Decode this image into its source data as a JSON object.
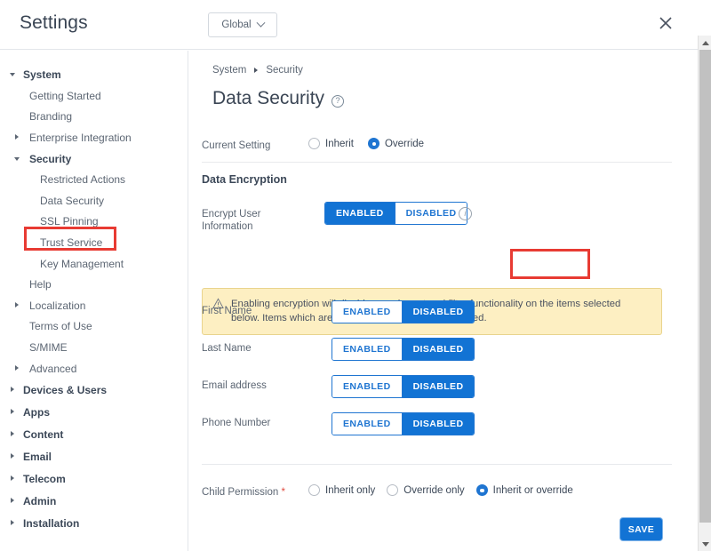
{
  "header": {
    "title": "Settings",
    "scope_label": "Global",
    "scope_icon": "chevron-down-icon",
    "close_icon": "close-icon"
  },
  "sidebar": {
    "items": [
      {
        "label": "System",
        "level": 0,
        "expanded": true,
        "icon": "caret-down-icon",
        "bold": true
      },
      {
        "label": "Getting Started",
        "level": 1,
        "expanded": null,
        "icon": "",
        "bold": false
      },
      {
        "label": "Branding",
        "level": 1,
        "expanded": null,
        "icon": "",
        "bold": false
      },
      {
        "label": "Enterprise Integration",
        "level": 1,
        "expanded": false,
        "icon": "caret-right-icon",
        "bold": false
      },
      {
        "label": "Security",
        "level": 1,
        "expanded": true,
        "icon": "caret-down-icon",
        "bold": true
      },
      {
        "label": "Restricted Actions",
        "level": 2,
        "expanded": null,
        "icon": "",
        "bold": false
      },
      {
        "label": "Data Security",
        "level": 2,
        "expanded": null,
        "icon": "",
        "bold": true
      },
      {
        "label": "SSL Pinning",
        "level": 2,
        "expanded": null,
        "icon": "",
        "bold": false
      },
      {
        "label": "Trust Service",
        "level": 2,
        "expanded": null,
        "icon": "",
        "bold": false
      },
      {
        "label": "Key Management",
        "level": 2,
        "expanded": null,
        "icon": "",
        "bold": false
      },
      {
        "label": "Help",
        "level": 1,
        "expanded": null,
        "icon": "",
        "bold": false
      },
      {
        "label": "Localization",
        "level": 1,
        "expanded": false,
        "icon": "caret-right-icon",
        "bold": false
      },
      {
        "label": "Terms of Use",
        "level": 1,
        "expanded": null,
        "icon": "",
        "bold": false
      },
      {
        "label": "S/MIME",
        "level": 1,
        "expanded": null,
        "icon": "",
        "bold": false
      },
      {
        "label": "Advanced",
        "level": 1,
        "expanded": false,
        "icon": "caret-right-icon",
        "bold": false
      },
      {
        "label": "Devices & Users",
        "level": 0,
        "expanded": false,
        "icon": "caret-right-icon",
        "bold": true
      },
      {
        "label": "Apps",
        "level": 0,
        "expanded": false,
        "icon": "caret-right-icon",
        "bold": true
      },
      {
        "label": "Content",
        "level": 0,
        "expanded": false,
        "icon": "caret-right-icon",
        "bold": true
      },
      {
        "label": "Email",
        "level": 0,
        "expanded": false,
        "icon": "caret-right-icon",
        "bold": true
      },
      {
        "label": "Telecom",
        "level": 0,
        "expanded": false,
        "icon": "caret-right-icon",
        "bold": true
      },
      {
        "label": "Admin",
        "level": 0,
        "expanded": false,
        "icon": "caret-right-icon",
        "bold": true
      },
      {
        "label": "Installation",
        "level": 0,
        "expanded": false,
        "icon": "caret-right-icon",
        "bold": true
      }
    ],
    "highlighted_item": "Data Security",
    "highlight_color": "#e83b33"
  },
  "main": {
    "breadcrumb": [
      "System",
      "Security"
    ],
    "page_title": "Data Security",
    "help_icon": "question-mark-icon",
    "current_setting": {
      "label": "Current Setting",
      "options": [
        {
          "label": "Inherit",
          "checked": false
        },
        {
          "label": "Override",
          "checked": true
        }
      ]
    },
    "section_title": "Data Encryption",
    "encrypt_user_info": {
      "label_line1": "Encrypt User",
      "label_line2": "Information",
      "enabled_label": "ENABLED",
      "disabled_label": "DISABLED",
      "selected": "ENABLED",
      "info_icon": "info-icon",
      "highlighted": true
    },
    "warning": {
      "icon": "warning-triangle-icon",
      "text": "Enabling encryption will disable search, sort and filter functionality on the items selected below. Items which are not selected will not be encrypted."
    },
    "field_toggles": [
      {
        "label": "First Name",
        "enabled_label": "ENABLED",
        "disabled_label": "DISABLED",
        "selected": "DISABLED"
      },
      {
        "label": "Last Name",
        "enabled_label": "ENABLED",
        "disabled_label": "DISABLED",
        "selected": "DISABLED"
      },
      {
        "label": "Email address",
        "enabled_label": "ENABLED",
        "disabled_label": "DISABLED",
        "selected": "DISABLED"
      },
      {
        "label": "Phone Number",
        "enabled_label": "ENABLED",
        "disabled_label": "DISABLED",
        "selected": "DISABLED"
      }
    ],
    "child_permission": {
      "label": "Child Permission",
      "required_marker": "*",
      "options": [
        {
          "label": "Inherit only",
          "checked": false
        },
        {
          "label": "Override only",
          "checked": false
        },
        {
          "label": "Inherit or override",
          "checked": true
        }
      ]
    },
    "save_label": "SAVE"
  },
  "colors": {
    "accent_blue": "#1273d4",
    "highlight_red": "#e83b33",
    "warning_bg": "#fdefc2",
    "warning_border": "#e9d48d"
  },
  "scrollbar": {
    "up_icon": "scroll-up-arrow-icon",
    "down_icon": "scroll-down-arrow-icon"
  }
}
